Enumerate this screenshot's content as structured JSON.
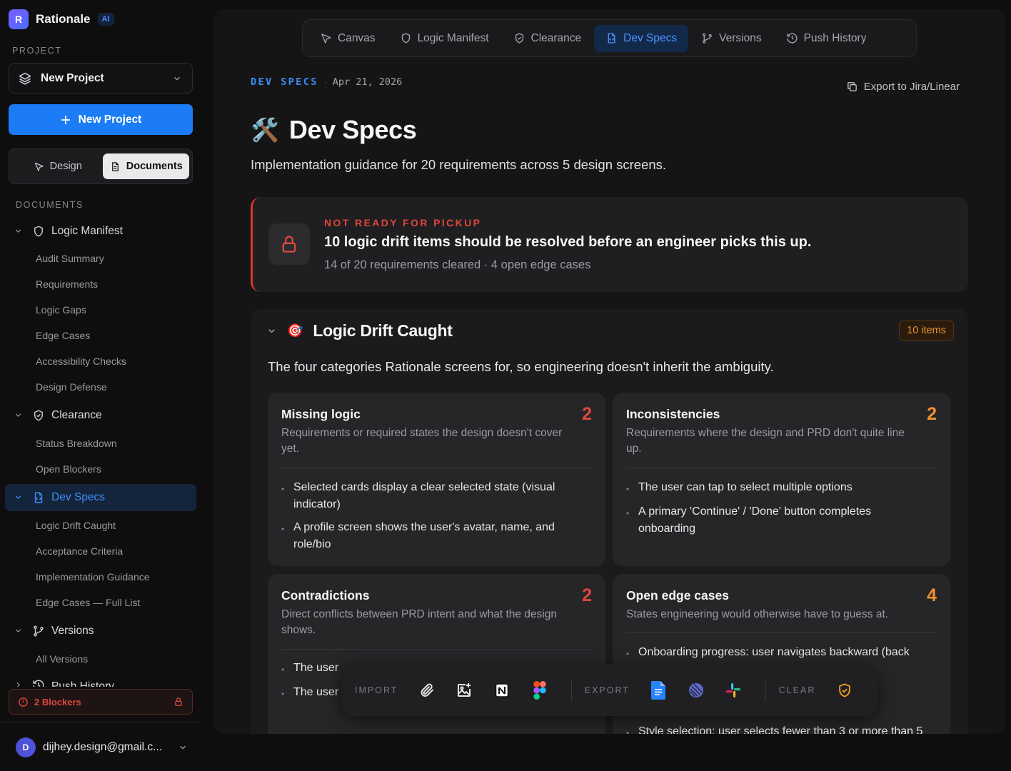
{
  "app": {
    "logo_letter": "R",
    "name": "Rationale",
    "badge": "AI"
  },
  "sidebar": {
    "project_label": "PROJECT",
    "project_selected": "New Project",
    "new_project_button": "New Project",
    "mode_toggle": {
      "design": "Design",
      "documents": "Documents",
      "active": "Documents"
    },
    "documents_label": "DOCUMENTS",
    "tree": [
      {
        "label": "Logic Manifest",
        "children": [
          "Audit Summary",
          "Requirements",
          "Logic Gaps",
          "Edge Cases",
          "Accessibility Checks",
          "Design Defense"
        ]
      },
      {
        "label": "Clearance",
        "children": [
          "Status Breakdown",
          "Open Blockers"
        ]
      },
      {
        "label": "Dev Specs",
        "active": true,
        "children": [
          "Logic Drift Caught",
          "Acceptance Criteria",
          "Implementation Guidance",
          "Edge Cases — Full List"
        ]
      },
      {
        "label": "Versions",
        "children": [
          "All Versions"
        ]
      },
      {
        "label": "Push History",
        "children": []
      }
    ],
    "blockers": "2 Blockers",
    "user": {
      "initial": "D",
      "email": "dijhey.design@gmail.c..."
    }
  },
  "tabs": [
    "Canvas",
    "Logic Manifest",
    "Clearance",
    "Dev Specs",
    "Versions",
    "Push History"
  ],
  "active_tab": "Dev Specs",
  "header": {
    "eyebrow": "DEV SPECS",
    "separator": "·",
    "date": "Apr 21, 2026",
    "export_label": "Export to Jira/Linear",
    "title_icon": "🛠️",
    "title": "Dev Specs",
    "subtitle": "Implementation guidance for 20 requirements across 5 design screens."
  },
  "alert": {
    "kicker": "NOT READY FOR PICKUP",
    "message": "10 logic drift items should be resolved before an engineer picks this up.",
    "meta": "14 of 20 requirements cleared · 4 open edge cases"
  },
  "drift": {
    "icon": "🎯",
    "title": "Logic Drift Caught",
    "count_badge": "10 items",
    "intro": "The four categories Rationale screens for, so engineering doesn't inherit the ambiguity.",
    "cards": [
      {
        "title": "Missing logic",
        "count": "2",
        "color": "#e0463d",
        "desc": "Requirements or required states the design doesn't cover yet.",
        "items": [
          "Selected cards display a clear selected state (visual indicator)",
          "A profile screen shows the user's avatar, name, and role/bio"
        ]
      },
      {
        "title": "Inconsistencies",
        "count": "2",
        "color": "#f0912d",
        "desc": "Requirements where the design and PRD don't quite line up.",
        "items": [
          "The user can tap to select multiple options",
          "A primary 'Continue' / 'Done' button completes onboarding"
        ]
      },
      {
        "title": "Contradictions",
        "count": "2",
        "color": "#e0463d",
        "desc": "Direct conflicts between PRD intent and what the design shows.",
        "items": [
          "The user",
          "The user"
        ]
      },
      {
        "title": "Open edge cases",
        "count": "4",
        "color": "#f0912d",
        "desc": "States engineering would otherwise have to guess at.",
        "items": [
          "Onboarding progress: user navigates backward (back",
          "Style selection: user selects fewer than 3 or more than 5"
        ]
      }
    ]
  },
  "dock": {
    "import_label": "IMPORT",
    "import_icons": [
      "paperclip-icon",
      "image-plus-icon",
      "notion-icon",
      "figma-icon"
    ],
    "export_label": "EXPORT",
    "export_icons": [
      "google-docs-icon",
      "linear-icon",
      "slack-icon"
    ],
    "clear_label": "CLEAR",
    "clear_icons": [
      "shield-check-icon"
    ]
  },
  "colors": {
    "accent": "#1b7cf5",
    "danger": "#e0463d",
    "warning": "#f0912d",
    "background": "#0e0e0f",
    "surface": "#151516"
  }
}
